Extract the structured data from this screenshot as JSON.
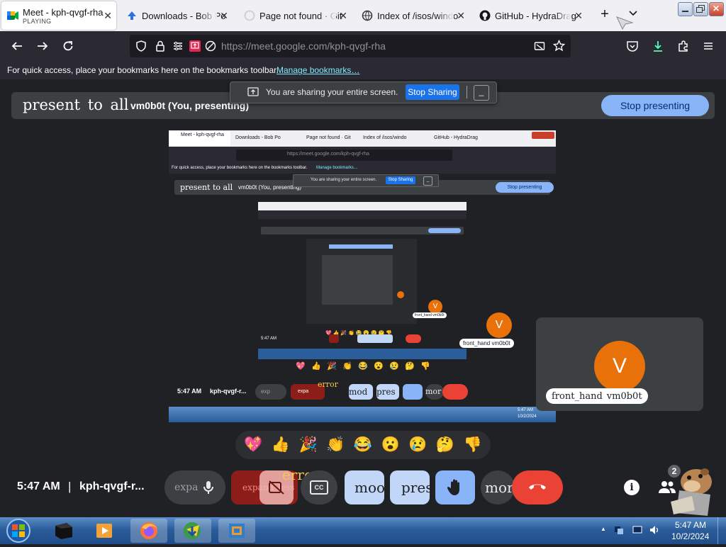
{
  "browser": {
    "tabs": [
      {
        "title": "Meet - kph-qvgf-rha",
        "subtitle": "PLAYING",
        "icon": "meet-icon",
        "active": true
      },
      {
        "title": "Downloads - Bob Po",
        "icon": "downloads-icon"
      },
      {
        "title": "Page not found · Git",
        "icon": "github-icon"
      },
      {
        "title": "Index of /isos/windo",
        "icon": "globe-icon"
      },
      {
        "title": "GitHub - HydraDrag",
        "icon": "github-icon"
      }
    ],
    "new_tab_symbol": "+",
    "tab_list_symbol": "⌄",
    "url": "https://meet.google.com/kph-qvgf-rha",
    "bookmarks_message": "For quick access, place your bookmarks here on the bookmarks toolbar.",
    "manage_bookmarks_link": "Manage bookmarks…"
  },
  "sharing_banner": {
    "message": "You are sharing your entire screen.",
    "stop_label": "Stop Sharing",
    "minimize_symbol": "_"
  },
  "presentation_bar": {
    "title": "present to all",
    "presenter": "vm0b0t (You, presenting)",
    "stop_label": "Stop presenting"
  },
  "nested_preview": {
    "tabs": [
      "Meet - kph-qvgf-rha",
      "Downloads - Bob Po",
      "Page not found · Git",
      "Index of /isos/windo",
      "GitHub - HydraDrag"
    ],
    "url": "https://meet.google.com/kph-qvgf-rha",
    "bookmarks_message": "For quick access, place your bookmarks here on the bookmarks toolbar.",
    "manage_link": "Manage bookmarks…",
    "banner_message": "You are sharing your entire screen.",
    "banner_stop": "Stop Sharing",
    "banner_min": "_",
    "present_title": "present to all",
    "presenter": "vm0b0t (You, presenting)",
    "stop_label": "Stop presenting",
    "time": "5:47 AM",
    "meeting": "kph-qvgf-r...",
    "btn_expand": "exp",
    "btn_error": "error",
    "btn_expand2": "expa",
    "btn_mood": "mod",
    "btn_present": "pres",
    "btn_more": "mor",
    "participant_initial": "V",
    "participant_label": "front_hand vm0b0t",
    "small_participant_label": "front_hand vm0b0t",
    "deep_participant_label": "front_hand vm0b0t",
    "tray_time": "5:47 AM",
    "tray_date": "10/2/2024"
  },
  "participant_tile": {
    "initial": "V",
    "avatar_color": "#e8710a",
    "hand_label": "front_hand",
    "name": "vm0b0t"
  },
  "reactions": [
    "💖",
    "👍",
    "🎉",
    "👏",
    "😂",
    "😮",
    "😢",
    "🤔",
    "👎"
  ],
  "bottom_bar": {
    "time": "5:47 AM",
    "separator": "|",
    "meeting_code": "kph-qvgf-r...",
    "controls": {
      "expand_label": "expa",
      "mic_icon": "mic-icon",
      "camera_off_label": "expand_less",
      "error_label": "error",
      "captions_label": "CC",
      "mood_label": "moo",
      "present_label": "pres",
      "hand_icon": "hand-icon",
      "more_label": "mor",
      "hangup_icon": "hangup-icon"
    },
    "info_icon": "info-icon",
    "people_icon": "people-icon",
    "people_count": "2"
  },
  "taskbar": {
    "apps": [
      "file-explorer-icon",
      "media-player-icon",
      "firefox-icon",
      "idm-icon",
      "virtualbox-icon"
    ],
    "tray_time": "5:47 AM",
    "tray_date": "10/2/2024",
    "show_hidden_symbol": "▲"
  },
  "colors": {
    "meet_bg": "#202124",
    "surface": "#3c4043",
    "accent_blue": "#8ab4f8",
    "share_blue": "#1a73e8",
    "hangup_red": "#ea4335",
    "error_red": "#8c1d18",
    "control_blue": "#c2d7f8",
    "taskbar_blue": "#2b5d9a"
  }
}
